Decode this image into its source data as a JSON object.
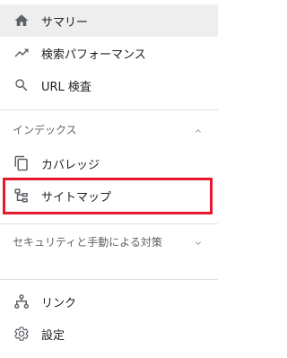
{
  "nav": {
    "items": [
      {
        "label": "サマリー",
        "icon": "home-icon"
      },
      {
        "label": "検索パフォーマンス",
        "icon": "trending-up-icon"
      },
      {
        "label": "URL 検査",
        "icon": "search-icon"
      }
    ],
    "index_section": {
      "title": "インデックス",
      "items": [
        {
          "label": "カバレッジ",
          "icon": "copy-icon"
        },
        {
          "label": "サイトマップ",
          "icon": "sitemap-icon"
        }
      ]
    },
    "security_section": {
      "title": "セキュリティと手動による対策"
    },
    "bottom_items": [
      {
        "label": "リンク",
        "icon": "links-icon"
      },
      {
        "label": "設定",
        "icon": "settings-icon"
      }
    ]
  },
  "colors": {
    "active_bg": "#eeeeee",
    "highlight_border": "#e8192c",
    "icon": "#5f6368",
    "text": "#202124"
  }
}
